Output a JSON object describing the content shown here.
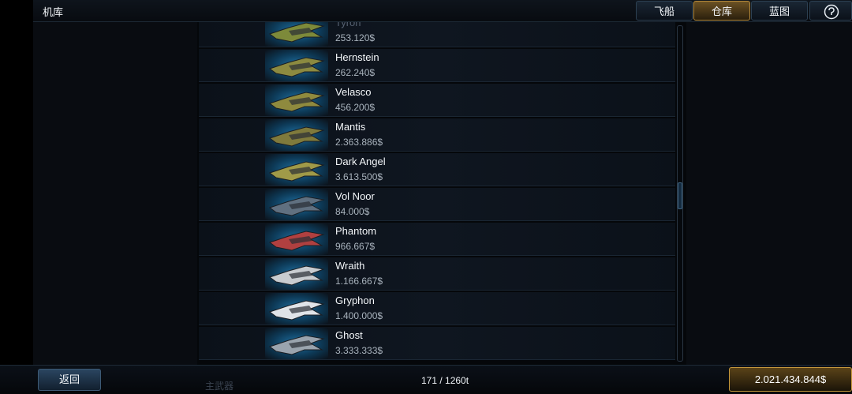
{
  "header": {
    "title": "机库",
    "tabs": [
      {
        "label": "飞船",
        "active": false
      },
      {
        "label": "仓库",
        "active": true
      },
      {
        "label": "蓝图",
        "active": false
      }
    ],
    "help_icon": "question-icon"
  },
  "ships": [
    {
      "name": "Tyron",
      "price": "253.120$",
      "color": "#7d8a3a"
    },
    {
      "name": "Hernstein",
      "price": "262.240$",
      "color": "#8c8a40"
    },
    {
      "name": "Velasco",
      "price": "456.200$",
      "color": "#8f8a3e"
    },
    {
      "name": "Mantis",
      "price": "2.363.886$",
      "color": "#7f7a3c"
    },
    {
      "name": "Dark Angel",
      "price": "3.613.500$",
      "color": "#a09a48"
    },
    {
      "name": "Vol Noor",
      "price": "84.000$",
      "color": "#607080"
    },
    {
      "name": "Phantom",
      "price": "966.667$",
      "color": "#b04040"
    },
    {
      "name": "Wraith",
      "price": "1.166.667$",
      "color": "#c8ccd0"
    },
    {
      "name": "Gryphon",
      "price": "1.400.000$",
      "color": "#e0e4e8"
    },
    {
      "name": "Ghost",
      "price": "3.333.333$",
      "color": "#9aa4ae"
    }
  ],
  "footer": {
    "back_label": "返回",
    "capacity": "171 / 1260t",
    "faded_label": "主武器",
    "money": "2.021.434.844$"
  },
  "colors": {
    "accent_gold": "#c89a3c",
    "panel_blue": "#1e6fa0"
  }
}
